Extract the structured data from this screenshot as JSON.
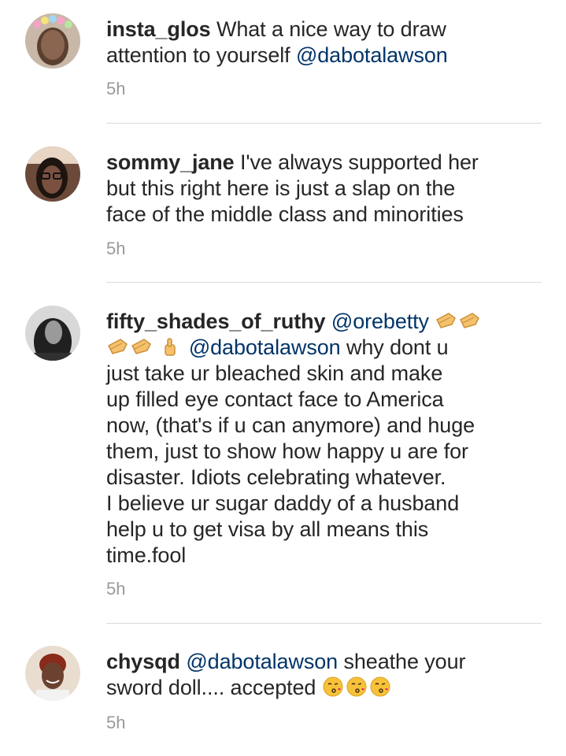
{
  "comments": [
    {
      "username": "insta_glos",
      "lines": [
        {
          "text": "What a nice way to draw",
          "mention": ""
        },
        {
          "text": "attention to yourself ",
          "mention": "@dabotalawson"
        }
      ],
      "time": "5h",
      "avatar_icon": "user-avatar-flower-crown"
    },
    {
      "username": "sommy_jane",
      "lines": [
        "I've always supported her",
        "but this right here is just a slap on the",
        "face of the middle class and minorities"
      ],
      "time": "5h",
      "avatar_icon": "user-avatar-glasses"
    },
    {
      "username": "fifty_shades_of_ruthy",
      "mention_first": "@orebetty",
      "mention_second": "@dabotalawson",
      "after_second_mention": " why dont u",
      "lines": [
        "just take ur bleached skin and make",
        "up filled eye contact face to America",
        "now, (that's if u can anymore) and huge",
        "them, just to show how happy u are for",
        "disaster. Idiots celebrating whatever.",
        "I believe ur sugar daddy of a husband",
        "help u to get visa by all means this",
        "time.fool"
      ],
      "time": "5h",
      "avatar_icon": "user-avatar-long-hair",
      "emoji": [
        "clapping-hands-emoji",
        "clapping-hands-emoji",
        "clapping-hands-emoji",
        "clapping-hands-emoji",
        "thumbs-up-emoji"
      ]
    },
    {
      "username": "chysqd",
      "mention": "@dabotalawson",
      "line1_rest": " sheathe your",
      "line2": "sword doll.... accepted ",
      "time": "5h",
      "avatar_icon": "user-avatar-smiling",
      "emoji": [
        "kissing-face-emoji",
        "kissing-face-emoji",
        "kissing-face-emoji"
      ]
    }
  ],
  "colors": {
    "text": "#262626",
    "mention": "#003569",
    "timestamp": "#999999",
    "divider": "#dbdbdb",
    "emoji_skin": "#f5c16c"
  }
}
